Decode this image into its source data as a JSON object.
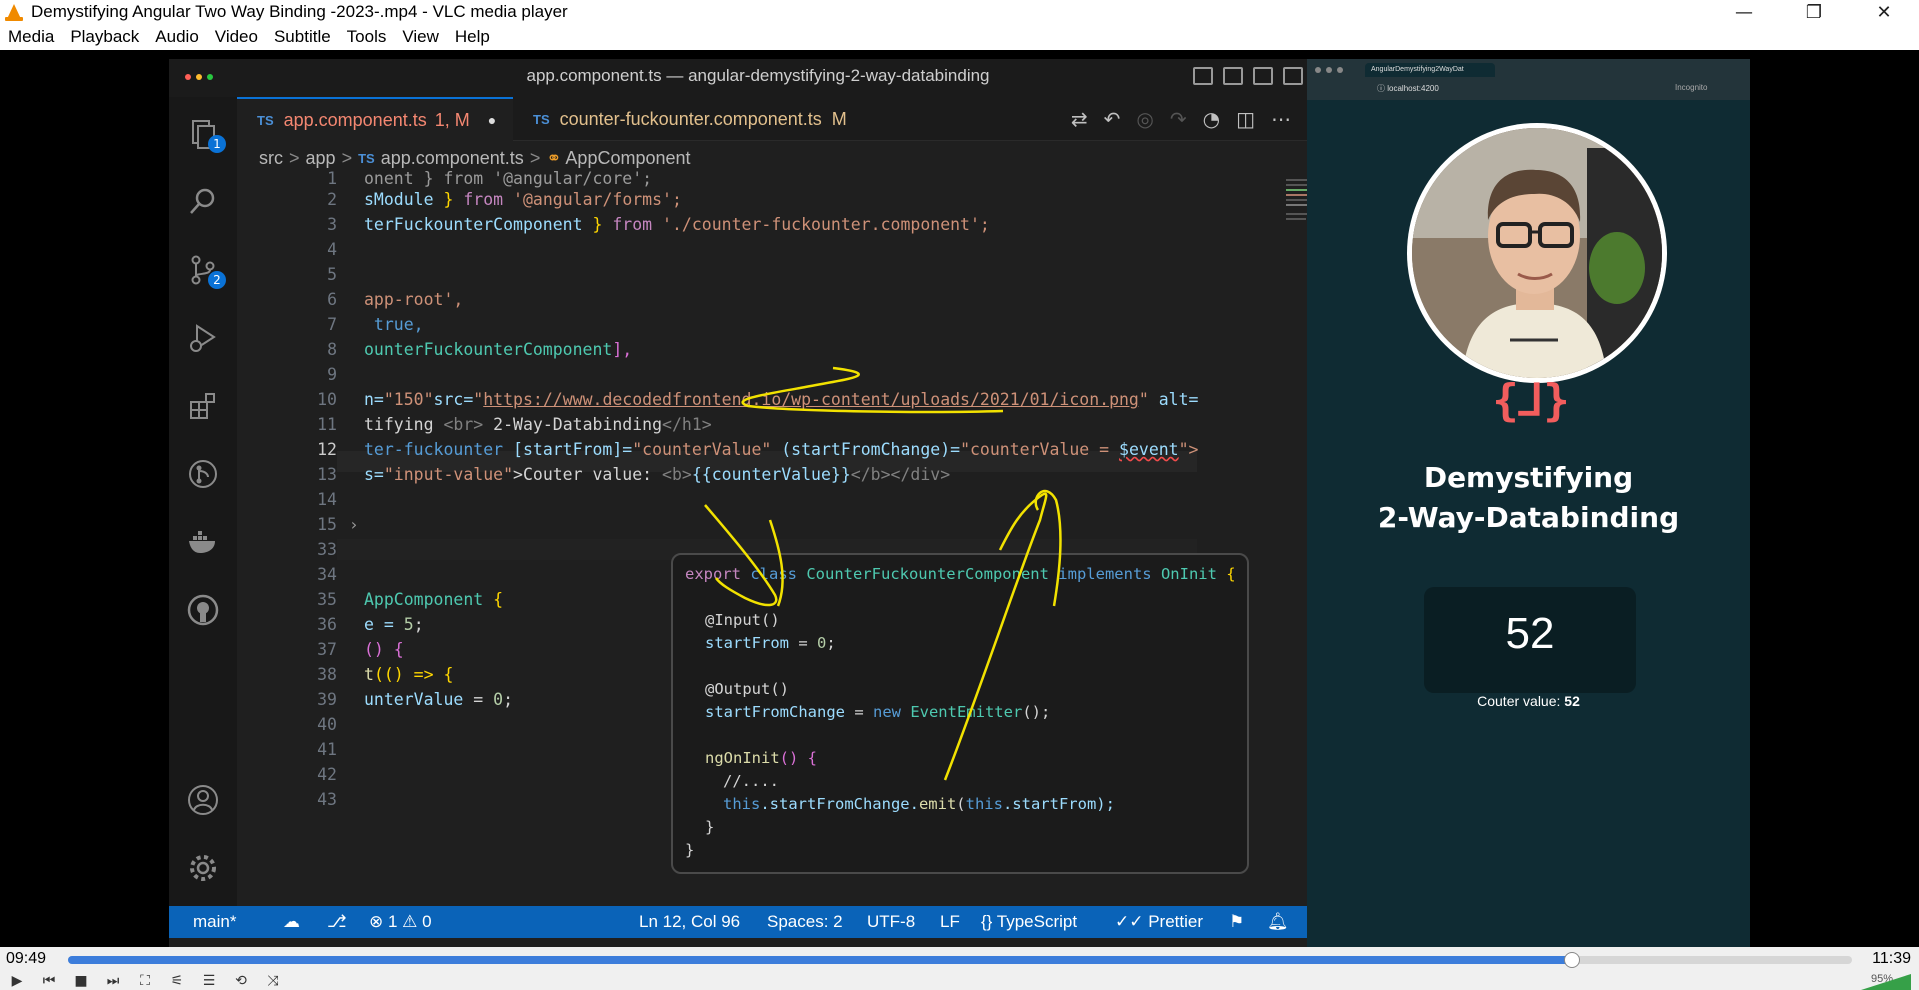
{
  "window": {
    "title": "Demystifying Angular Two Way Binding -2023-.mp4 - VLC media player",
    "minimize": "—",
    "restore": "❐",
    "close": "✕"
  },
  "menu": [
    "Media",
    "Playback",
    "Audio",
    "Video",
    "Subtitle",
    "Tools",
    "View",
    "Help"
  ],
  "vscode": {
    "title": "app.component.ts — angular-demystifying-2-way-databinding",
    "tabs": [
      {
        "lang": "TS",
        "name": "app.component.ts",
        "status": "1, M",
        "dirty": "●"
      },
      {
        "lang": "TS",
        "name": "counter-fuckounter.component.ts",
        "status": "M"
      }
    ],
    "breadcrumb": {
      "p1": "src",
      "p2": "app",
      "lang": "TS",
      "file": "app.component.ts",
      "symbol": "AppComponent"
    },
    "activity_badges": {
      "explorer": "1",
      "scm": "2"
    },
    "line_numbers": [
      "1",
      "2",
      "3",
      "4",
      "5",
      "6",
      "7",
      "8",
      "9",
      "10",
      "11",
      "12",
      "13",
      "14",
      "15",
      "33",
      "34",
      "35",
      "36",
      "37",
      "38",
      "39",
      "40",
      "41",
      "42",
      "43"
    ],
    "code": {
      "l1": "onent } from '@angular/core';",
      "l2a": "sModule",
      "l2b": " } ",
      "l2c": "from",
      "l2d": " '@angular/forms';",
      "l3a": "terFuckounterComponent",
      "l3b": " } ",
      "l3c": "from",
      "l3d": " './counter-fuckounter.component';",
      "l6": "app-root',",
      "l7": " true,",
      "l8a": "ounterFuckounterComponent",
      "l8b": "],",
      "l10a": "n=",
      "l10b": "\"150\"",
      "l10c": "src=",
      "l10d": "\"",
      "l10e": "https://www.decodedfrontend.io/wp-content/uploads/2021/01/icon.png",
      "l10f": "\"",
      "l10g": " alt=",
      "l11a": "tifying ",
      "l11b": "<br>",
      "l11c": " 2-Way-Databinding",
      "l11d": "</h1>",
      "l12a": "ter-fuckounter ",
      "l12b": "[startFrom]=",
      "l12c": "\"counterValue\"",
      "l12d": " (startFromChange)=",
      "l12e": "\"counterValue = ",
      "l12f": "$event",
      "l12g": "\">",
      "l13a": "s=",
      "l13b": "\"input-value\"",
      "l13c": ">Couter value: ",
      "l13d": "<b>",
      "l13e": "{{counterValue}}",
      "l13f": "</b></div>",
      "l35a": "AppComponent",
      "l35b": " {",
      "l36a": "e = ",
      "l36b": "5",
      "l36c": ";",
      "l37": "() {",
      "l38a": "t",
      "l38b": "(() => {",
      "l39a": "unterValue",
      "l39b": " = ",
      "l39c": "0",
      "l39d": ";"
    },
    "card": {
      "c1a": "export",
      "c1b": " class ",
      "c1c": "CounterFuckounterComponent",
      "c1d": " implements ",
      "c1e": "OnInit",
      "c1f": " {",
      "c2": "@Input()",
      "c3a": "startFrom",
      "c3b": " = ",
      "c3c": "0",
      "c3d": ";",
      "c4": "@Output()",
      "c5a": "startFromChange",
      "c5b": " = ",
      "c5c": "new",
      "c5d": " EventEmitter",
      "c5e": "();",
      "c6a": "ngOnInit",
      "c6b": "() {",
      "c7": "//....",
      "c8a": "this",
      "c8b": ".startFromChange.",
      "c8c": "emit",
      "c8d": "(",
      "c8e": "this",
      "c8f": ".startFrom);",
      "c9": "}",
      "c10": "}"
    },
    "status": {
      "branch": "main*",
      "problems": "⊗ 1 ⚠ 0",
      "position": "Ln 12, Col 96",
      "spaces": "Spaces: 2",
      "encoding": "UTF-8",
      "eol": "LF",
      "language": "{} TypeScript",
      "formatter": "✓✓ Prettier"
    }
  },
  "browser": {
    "tab_title": "AngularDemystifying2WayDat",
    "url": "localhost:4200",
    "incognito": "Incognito",
    "logo": "{⅃}",
    "heading1": "Demystifying",
    "heading2": "2-Way-Databinding",
    "counter": "52",
    "couter_label": "Couter value: ",
    "couter_value": "52"
  },
  "player": {
    "time_elapsed": "09:49",
    "time_total": "11:39",
    "progress": 0.843,
    "volume": "95%"
  },
  "colors": {
    "statusbar": "#0a63b8",
    "accent": "#0a72d6",
    "seek": "#3c7ddb",
    "annotation": "#f2e200"
  }
}
